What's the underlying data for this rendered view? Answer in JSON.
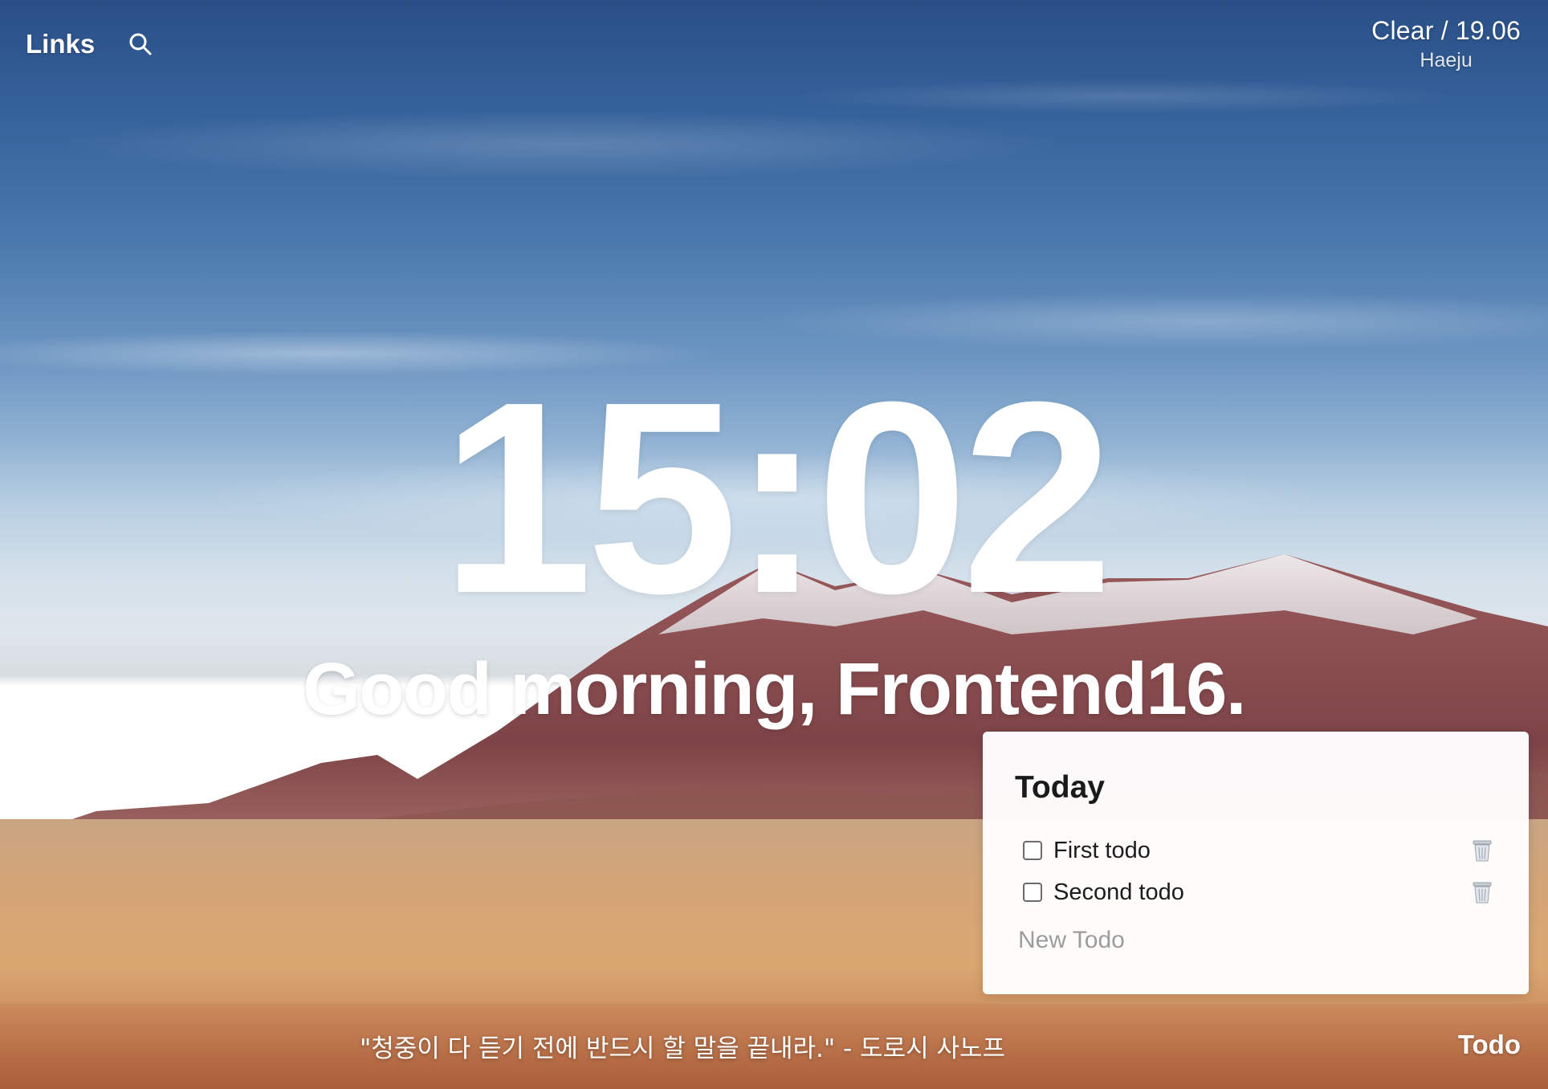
{
  "header": {
    "links_label": "Links",
    "search_icon": "search-icon"
  },
  "weather": {
    "summary": "Clear / 19.06",
    "city": "Haeju"
  },
  "clock": {
    "time": "15:02"
  },
  "greeting": {
    "text": "Good morning, Frontend16."
  },
  "todo": {
    "title": "Today",
    "items": [
      {
        "label": "First todo",
        "checked": false
      },
      {
        "label": "Second todo",
        "checked": false
      }
    ],
    "new_placeholder": "New Todo",
    "delete_icon": "trash-icon"
  },
  "footer": {
    "quote": "\"청중이 다 듣기 전에 반드시 할 말을 끝내라.\" - 도로시 사노프",
    "todo_toggle_label": "Todo"
  },
  "colors": {
    "panel_bg": "#ffffff",
    "text_light": "#ffffff",
    "placeholder": "#9c9c9c"
  }
}
